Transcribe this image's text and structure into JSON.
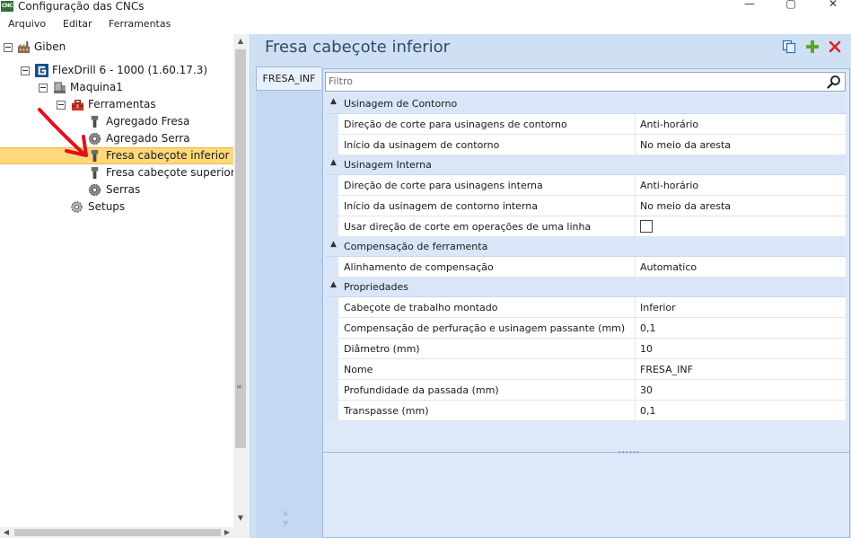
{
  "window": {
    "app_icon_text": "CNC",
    "title": "Configuração das CNCs",
    "minimize_glyph": "—",
    "maximize_glyph": "▢",
    "close_glyph": "✕"
  },
  "menu": {
    "items": [
      "Arquivo",
      "Editar",
      "Ferramentas"
    ]
  },
  "tree": {
    "nodes": [
      {
        "label": "Giben",
        "icon": "factory-icon"
      },
      {
        "label": "FlexDrill 6 - 1000 (1.60.17.3)",
        "icon": "giben-logo-icon"
      },
      {
        "label": "Maquina1",
        "icon": "machine-icon"
      },
      {
        "label": "Ferramentas",
        "icon": "toolbox-icon"
      },
      {
        "label": "Agregado Fresa",
        "icon": "router-bit-icon"
      },
      {
        "label": "Agregado Serra",
        "icon": "saw-gear-icon"
      },
      {
        "label": "Fresa cabeçote inferior",
        "icon": "router-bit-icon"
      },
      {
        "label": "Fresa cabeçote superior",
        "icon": "router-bit-icon"
      },
      {
        "label": "Serras",
        "icon": "saw-gear-icon"
      },
      {
        "label": "Setups",
        "icon": "settings-gear-icon"
      }
    ],
    "selected": "Fresa cabeçote inferior"
  },
  "main": {
    "title": "Fresa cabeçote inferior",
    "tab_label": "FRESA_INF",
    "filter_placeholder": "Filtro",
    "categories": [
      {
        "label": "Usinagem de Contorno",
        "props": [
          {
            "name": "Direção de corte para usinagens de contorno",
            "value": "Anti-horário"
          },
          {
            "name": "Início da usinagem de contorno",
            "value": "No meio da aresta"
          }
        ]
      },
      {
        "label": "Usinagem Interna",
        "props": [
          {
            "name": "Direção de corte para usinagens interna",
            "value": "Anti-horário"
          },
          {
            "name": "Início da usinagem de contorno interna",
            "value": "No meio da aresta"
          },
          {
            "name": "Usar direção de corte em operações de uma linha",
            "checked": false
          }
        ]
      },
      {
        "label": "Compensação de ferramenta",
        "props": [
          {
            "name": "Alinhamento de compensação",
            "value": "Automatico"
          }
        ]
      },
      {
        "label": "Propriedades",
        "props": [
          {
            "name": "Cabeçote de trabalho montado",
            "value": "Inferior"
          },
          {
            "name": "Compensação de perfuração e usinagem passante (mm)",
            "value": "0,1"
          },
          {
            "name": "Diâmetro (mm)",
            "value": "10"
          },
          {
            "name": "Nome",
            "value": "FRESA_INF"
          },
          {
            "name": "Profundidade da passada (mm)",
            "value": "30"
          },
          {
            "name": "Transpasse (mm)",
            "value": "0,1"
          }
        ]
      }
    ]
  },
  "colors": {
    "selected_row": "#ffd97a",
    "panel_bg": "#cfe0f5",
    "category_bg": "#d9e6f7",
    "title_text": "#2e4a6a"
  }
}
